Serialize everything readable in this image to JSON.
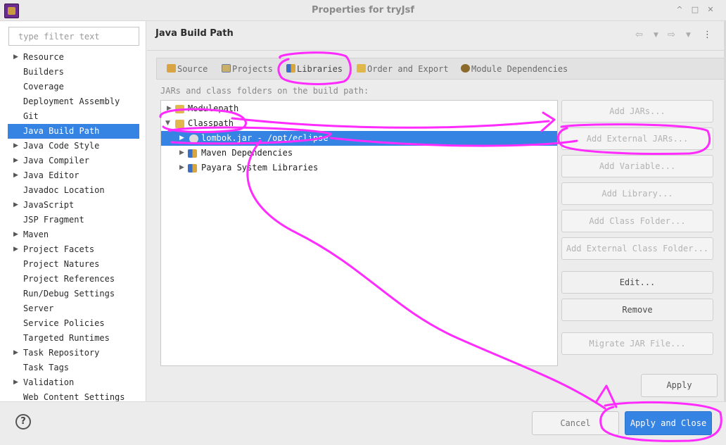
{
  "window": {
    "title": "Properties for tryJsf",
    "controls": [
      "^",
      "□",
      "✕"
    ]
  },
  "sidebar": {
    "filter_placeholder": "type filter text",
    "items": [
      {
        "label": "Resource",
        "expandable": true
      },
      {
        "label": "Builders",
        "expandable": false
      },
      {
        "label": "Coverage",
        "expandable": false
      },
      {
        "label": "Deployment Assembly",
        "expandable": false
      },
      {
        "label": "Git",
        "expandable": false
      },
      {
        "label": "Java Build Path",
        "expandable": false,
        "selected": true
      },
      {
        "label": "Java Code Style",
        "expandable": true
      },
      {
        "label": "Java Compiler",
        "expandable": true
      },
      {
        "label": "Java Editor",
        "expandable": true
      },
      {
        "label": "Javadoc Location",
        "expandable": false
      },
      {
        "label": "JavaScript",
        "expandable": true
      },
      {
        "label": "JSP Fragment",
        "expandable": false
      },
      {
        "label": "Maven",
        "expandable": true
      },
      {
        "label": "Project Facets",
        "expandable": true
      },
      {
        "label": "Project Natures",
        "expandable": false
      },
      {
        "label": "Project References",
        "expandable": false
      },
      {
        "label": "Run/Debug Settings",
        "expandable": false
      },
      {
        "label": "Server",
        "expandable": false
      },
      {
        "label": "Service Policies",
        "expandable": false
      },
      {
        "label": "Targeted Runtimes",
        "expandable": false
      },
      {
        "label": "Task Repository",
        "expandable": true
      },
      {
        "label": "Task Tags",
        "expandable": false
      },
      {
        "label": "Validation",
        "expandable": true
      },
      {
        "label": "Web Content Settings",
        "expandable": false
      }
    ]
  },
  "main": {
    "title": "Java Build Path",
    "tabs": [
      {
        "label": "Source",
        "icon": "source-folder-icon"
      },
      {
        "label": "Projects",
        "icon": "projects-icon"
      },
      {
        "label": "Libraries",
        "icon": "libraries-icon",
        "active": true
      },
      {
        "label": "Order and Export",
        "icon": "order-export-icon"
      },
      {
        "label": "Module Dependencies",
        "icon": "module-icon"
      }
    ],
    "path_label": "JARs and class folders on the build path:",
    "build_path": {
      "modulepath": "Modulepath",
      "classpath": "Classpath",
      "entries": [
        {
          "label": "lombok.jar - /opt/eclipse",
          "selected": true
        },
        {
          "label": "Maven Dependencies"
        },
        {
          "label": "Payara System Libraries"
        }
      ]
    },
    "buttons": [
      {
        "label": "Add JARs...",
        "enabled": false
      },
      {
        "label": "Add External JARs...",
        "enabled": false
      },
      {
        "label": "Add Variable...",
        "enabled": false
      },
      {
        "label": "Add Library...",
        "enabled": false
      },
      {
        "label": "Add Class Folder...",
        "enabled": false
      },
      {
        "label": "Add External Class Folder...",
        "enabled": false
      },
      {
        "label": "Edit...",
        "enabled": true
      },
      {
        "label": "Remove",
        "enabled": true
      },
      {
        "label": "Migrate JAR File...",
        "enabled": false
      }
    ],
    "apply_label": "Apply"
  },
  "footer": {
    "help_label": "?",
    "cancel_label": "Cancel",
    "apply_close_label": "Apply and Close"
  },
  "colors": {
    "selection": "#3584e4",
    "annotation": "#ff2bff"
  }
}
